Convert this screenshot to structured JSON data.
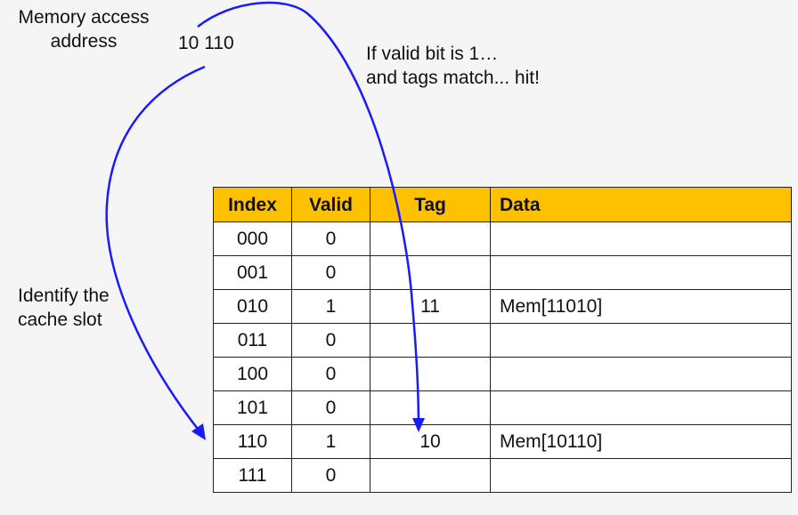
{
  "memory_label": [
    "Memory access",
    "address"
  ],
  "address_value": "10 110",
  "hit_label": [
    "If valid bit is 1…",
    "and tags match... hit!"
  ],
  "slot_label": [
    "Identify the",
    "cache slot"
  ],
  "table": {
    "headers": {
      "index": "Index",
      "valid": "Valid",
      "tag": "Tag",
      "data": "Data"
    },
    "rows": [
      {
        "index": "000",
        "valid": "0",
        "tag": "",
        "data": ""
      },
      {
        "index": "001",
        "valid": "0",
        "tag": "",
        "data": ""
      },
      {
        "index": "010",
        "valid": "1",
        "tag": "11",
        "data": "Mem[11010]"
      },
      {
        "index": "011",
        "valid": "0",
        "tag": "",
        "data": ""
      },
      {
        "index": "100",
        "valid": "0",
        "tag": "",
        "data": ""
      },
      {
        "index": "101",
        "valid": "0",
        "tag": "",
        "data": ""
      },
      {
        "index": "110",
        "valid": "1",
        "tag": "10",
        "data": "Mem[10110]"
      },
      {
        "index": "111",
        "valid": "0",
        "tag": "",
        "data": ""
      }
    ]
  },
  "colors": {
    "header_fill": "#ffc000",
    "arrow": "#1a1aff",
    "background": "#f5f5f5"
  }
}
